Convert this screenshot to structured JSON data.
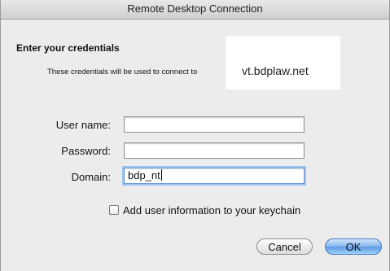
{
  "window": {
    "title": "Remote Desktop Connection"
  },
  "credentials": {
    "heading": "Enter your credentials",
    "description": "These credentials will be used to connect to",
    "server": "vt.bdplaw.net"
  },
  "form": {
    "username_label": "User name:",
    "username_value": "",
    "password_label": "Password:",
    "password_value": "",
    "domain_label": "Domain:",
    "domain_value": "bdp_nt",
    "keychain_label": "Add user information to your keychain",
    "keychain_checked": false
  },
  "buttons": {
    "cancel_label": "Cancel",
    "ok_label": "OK"
  },
  "colors": {
    "default_button": "#5b9ae4",
    "focus_ring": "#9cc1ef"
  }
}
